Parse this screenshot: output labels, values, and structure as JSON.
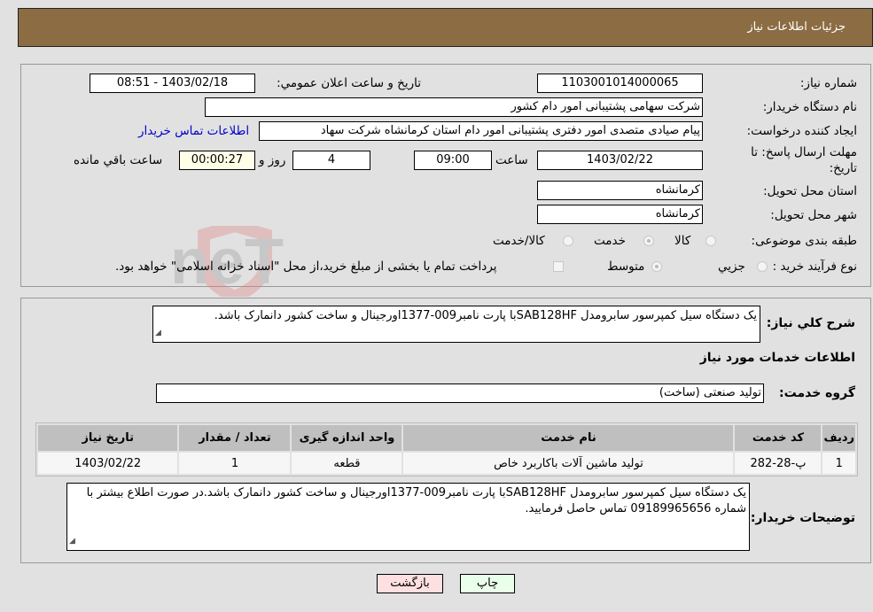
{
  "header": {
    "title": "جزئیات اطلاعات نیاز"
  },
  "form": {
    "need_number_label": "شماره نیاز:",
    "need_number": "1103001014000065",
    "announce_label": "تاریخ و ساعت اعلان عمومي:",
    "announce_value": "1403/02/18 - 08:51",
    "buyer_org_label": "نام دستگاه خریدار:",
    "buyer_org": "شرکت سهامی پشتیبانی امور دام کشور",
    "creator_label": "ایجاد کننده درخواست:",
    "creator": "پیام صیادی متصدی امور دفتری پشتیبانی امور دام استان کرمانشاه شرکت سهاد",
    "contact_link": "اطلاعات تماس خریدار",
    "deadline_label_1": "مهلت ارسال پاسخ: تا",
    "deadline_label_2": "تاریخ:",
    "deadline_date": "1403/02/22",
    "time_label": "ساعت",
    "deadline_time": "09:00",
    "days_value": "4",
    "days_label": "روز و",
    "remaining_value": "00:00:27",
    "remaining_label": "ساعت باقي مانده",
    "province_label": "استان محل تحویل:",
    "province": "کرمانشاه",
    "city_label": "شهر محل تحویل:",
    "city": "کرمانشاه",
    "category_label": "طبقه بندی موضوعی:",
    "category_options": [
      "کالا",
      "خدمت",
      "کالا/خدمت"
    ],
    "category_selected": "خدمت",
    "process_label": "نوع فرآیند خرید :",
    "process_options": [
      "جزيي",
      "متوسط"
    ],
    "process_selected": "متوسط",
    "treasury_note": "پرداخت تمام یا بخشی از مبلغ خرید،از محل \"اسناد خزانه اسلامی\" خواهد بود."
  },
  "details": {
    "summary_label": "شرح کلي نیاز:",
    "summary": "یک دستگاه سیل کمپرسور سابرومدل SAB128HFبا پارت نامبر009-1377اورجینال و ساخت کشور دانمارک باشد.",
    "services_heading": "اطلاعات خدمات مورد نیاز",
    "service_group_label": "گروه خدمت:",
    "service_group": "تولید صنعتی (ساخت)",
    "table": {
      "headers": [
        "ردیف",
        "کد خدمت",
        "نام خدمت",
        "واحد اندازه گیری",
        "تعداد / مقدار",
        "تاریخ نیاز"
      ],
      "rows": [
        [
          "1",
          "پ-28-282",
          "تولید ماشین آلات باکاربرد خاص",
          "قطعه",
          "1",
          "1403/02/22"
        ]
      ]
    },
    "buyer_notes_label": "توضیحات خریدار:",
    "buyer_notes": "یک دستگاه سیل کمپرسور سابرومدل SAB128HFبا پارت نامبر009-1377اورجینال و ساخت کشور دانمارک باشد.در صورت اطلاع بیشتر با شماره 09189965656 تماس حاصل فرمایید."
  },
  "buttons": {
    "print": "چاپ",
    "back": "بازگشت"
  },
  "watermark": {
    "text": "AriaTender.neT"
  }
}
